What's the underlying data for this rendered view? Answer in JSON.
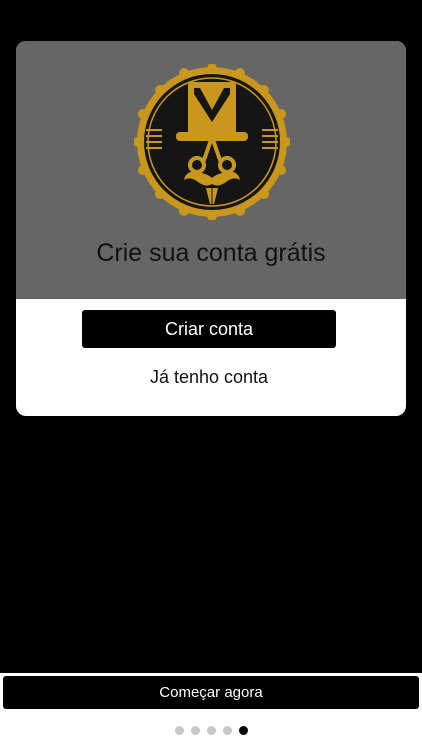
{
  "card": {
    "title": "Crie sua conta grátis",
    "create_account_label": "Criar conta",
    "have_account_label": "Já tenho conta"
  },
  "footer": {
    "start_label": "Começar agora",
    "pagination": {
      "total": 5,
      "active_index": 4
    }
  },
  "colors": {
    "background": "#000000",
    "card_top": "#666666",
    "logo_gold": "#c9971c",
    "logo_dark": "#151515",
    "dot_inactive": "#c8c8c8",
    "dot_active": "#000000"
  },
  "icons": {
    "logo": "barber-top-hat-scissors-mustache-logo"
  }
}
